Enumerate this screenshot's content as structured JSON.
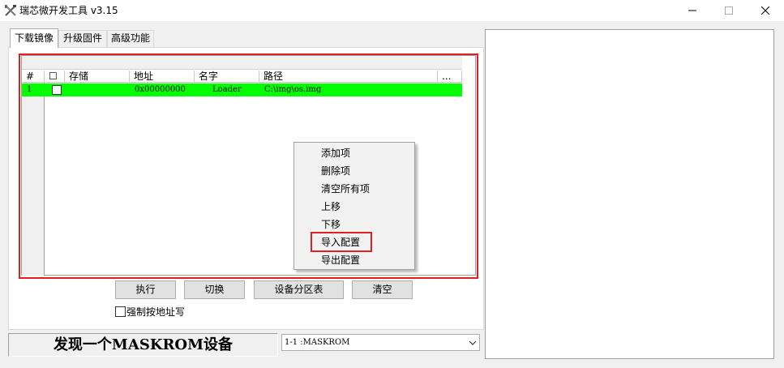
{
  "window": {
    "title": "瑞芯微开发工具 v3.15",
    "icon": "tools-icon",
    "controls": [
      "minimize-icon",
      "maximize-icon",
      "close-icon"
    ]
  },
  "tabs": [
    {
      "label": "下载镜像",
      "active": true
    },
    {
      "label": "升级固件",
      "active": false
    },
    {
      "label": "高级功能",
      "active": false
    }
  ],
  "grid": {
    "columns": [
      "#",
      "☐",
      "存储",
      "地址",
      "名字",
      "路径",
      "..."
    ],
    "rows": [
      {
        "num": "1",
        "checked": false,
        "storage": "",
        "address": "0x00000000",
        "name": "Loader",
        "path": "C:\\img\\os.img",
        "color": "#00ff00"
      }
    ]
  },
  "context_menu": {
    "items": [
      "添加项",
      "删除项",
      "清空所有项",
      "上移",
      "下移",
      "导入配置",
      "导出配置"
    ],
    "highlighted": "导入配置"
  },
  "buttons": {
    "run": "执行",
    "switch": "切换",
    "partition_table": "设备分区表",
    "clear": "清空"
  },
  "force_address": {
    "label": "强制按地址写",
    "checked": false
  },
  "status": {
    "message": "发现一个MASKROM设备"
  },
  "device_select": {
    "value": "1-1 :MASKROM"
  },
  "colors": {
    "highlight_red": "#e02020",
    "row_green": "#00ff00"
  }
}
